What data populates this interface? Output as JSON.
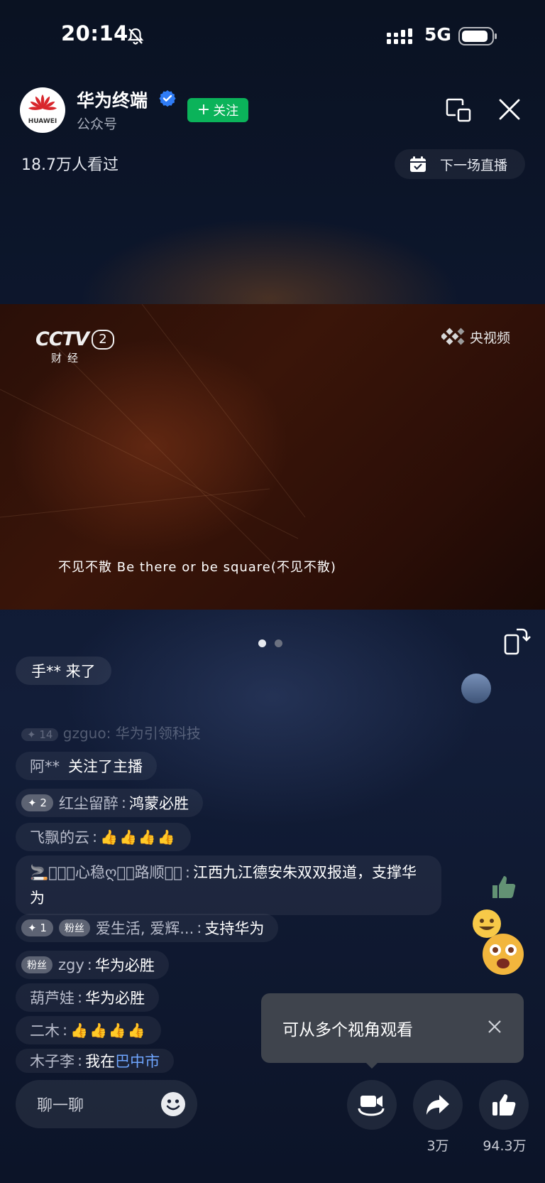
{
  "status_bar": {
    "time": "20:14",
    "network": "5G"
  },
  "header": {
    "channel_name": "华为终端",
    "channel_type": "公众号",
    "avatar_text": "HUAWEI",
    "follow_label": "关注",
    "viewers": "18.7万人看过",
    "next_live_label": "下一场直播"
  },
  "video": {
    "broadcaster_logo": "CCTV",
    "channel_number": "2",
    "channel_sub": "财经",
    "watermark": "央视频",
    "subtitle": "不见不散 Be there or be square(不见不散)"
  },
  "carousel": {
    "pages": 2,
    "active": 0
  },
  "chat": {
    "join_notice": "手** 来了",
    "faded_message": {
      "level": "14",
      "nick": "gzguo",
      "text": "华为引领科技"
    },
    "follow_notice": {
      "nick": "阿**",
      "text": "关注了主播"
    },
    "messages": [
      {
        "level": "2",
        "nick": "红尘留醉",
        "text": "鸿蒙必胜"
      },
      {
        "nick": "飞飘的云",
        "thumbs": 4
      },
      {
        "nick": "🚬꙰⃟ⓔ心稳ღ꙰⃟路顺꙰⃟",
        "text": "江西九江德安朱双双报道，支撑华为"
      },
      {
        "level": "1",
        "fan_badge": "粉丝",
        "nick": "爱生活, 爱辉...",
        "text": "支持华为"
      },
      {
        "fan_badge": "粉丝",
        "nick": "zgy",
        "text": "华为必胜"
      },
      {
        "nick": "葫芦娃",
        "text": "华为必胜"
      },
      {
        "nick": "二木",
        "thumbs": 4
      },
      {
        "nick": "木子李",
        "text_prefix": "我在",
        "text_city": "巴中市"
      }
    ]
  },
  "tooltip": {
    "text": "可从多个视角观看"
  },
  "bottom_bar": {
    "input_placeholder": "聊一聊",
    "share_count": "3万",
    "like_count": "94.3万"
  },
  "colors": {
    "follow_green": "#0bb35a",
    "verified_blue": "#2f7cf6",
    "city_link": "#6fa6ff",
    "huawei_red": "#d8262c"
  }
}
